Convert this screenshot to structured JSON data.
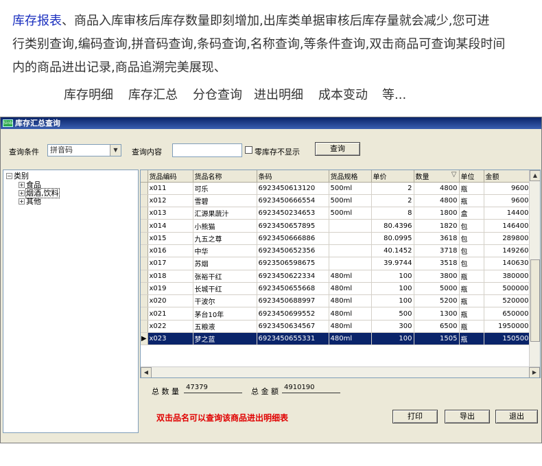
{
  "intro": {
    "highlight": "库存报表",
    "line1_rest": "、商品入库审核后库存数量即刻增加,出库类单据审核后库存量就会减少,您可进",
    "line2": "行类别查询,编码查询,拼音码查询,条码查询,名称查询,等条件查询,双击商品可查询某段时间",
    "line3": "内的商品进出记录,商品追溯完美展现、"
  },
  "features": [
    "库存明细",
    "库存汇总",
    "分仓查询",
    "进出明细",
    "成本变动",
    "等..."
  ],
  "window": {
    "icon_text": "Sinb",
    "title": "库存汇总查询"
  },
  "query": {
    "condition_label": "查询条件",
    "condition_value": "拼音码",
    "content_label": "查询内容",
    "content_value": "",
    "zero_stock_label": "零库存不显示",
    "query_button": "查询"
  },
  "tree": {
    "root": "类别",
    "children": [
      "食品",
      "烟酒,饮料",
      "其他"
    ]
  },
  "grid": {
    "columns": [
      "货品编码",
      "货品名称",
      "条码",
      "货品规格",
      "单价",
      "数量",
      "单位",
      "金额"
    ],
    "sort_indicator": "▽",
    "rows": [
      [
        "x011",
        "可乐",
        "6923450613120",
        "500ml",
        "2",
        "4800",
        "瓶",
        "9600"
      ],
      [
        "x012",
        "雪碧",
        "6923450666554",
        "500ml",
        "2",
        "4800",
        "瓶",
        "9600"
      ],
      [
        "x013",
        "汇源果蔬汁",
        "6923450234653",
        "500ml",
        "8",
        "1800",
        "盒",
        "14400"
      ],
      [
        "x014",
        "小熊猫",
        "6923450657895",
        "",
        "80.4396",
        "1820",
        "包",
        "146400"
      ],
      [
        "x015",
        "九五之尊",
        "6923450666886",
        "",
        "80.0995",
        "3618",
        "包",
        "289800"
      ],
      [
        "x016",
        "中华",
        "6923450652356",
        "",
        "40.1452",
        "3718",
        "包",
        "149260"
      ],
      [
        "x017",
        "苏烟",
        "6923506598675",
        "",
        "39.9744",
        "3518",
        "包",
        "140630"
      ],
      [
        "x018",
        "张裕干红",
        "6923450622334",
        "480ml",
        "100",
        "3800",
        "瓶",
        "380000"
      ],
      [
        "x019",
        "长城干红",
        "6923450655668",
        "480ml",
        "100",
        "5000",
        "瓶",
        "500000"
      ],
      [
        "x020",
        "干波尔",
        "6923450688997",
        "480ml",
        "100",
        "5200",
        "瓶",
        "520000"
      ],
      [
        "x021",
        "茅台10年",
        "6923450699552",
        "480ml",
        "500",
        "1300",
        "瓶",
        "650000"
      ],
      [
        "x022",
        "五粮液",
        "6923450634567",
        "480ml",
        "300",
        "6500",
        "瓶",
        "1950000"
      ],
      [
        "x023",
        "梦之蓝",
        "6923450655331",
        "480ml",
        "100",
        "1505",
        "瓶",
        "150500"
      ]
    ],
    "selected_row": 12,
    "row_indicator": "▶"
  },
  "summary": {
    "qty_label": "总 数 量",
    "qty_value": "47379",
    "amount_label": "总 金 额",
    "amount_value": "4910190"
  },
  "hint": "双击品名可以查询该商品进出明细表",
  "buttons": {
    "print": "打印",
    "export": "导出",
    "exit": "退出"
  },
  "colors": {
    "intro_highlight": "#1a2fbf",
    "titlebar": "#0a246a",
    "selection": "#0a246a",
    "hint": "#e00000"
  }
}
